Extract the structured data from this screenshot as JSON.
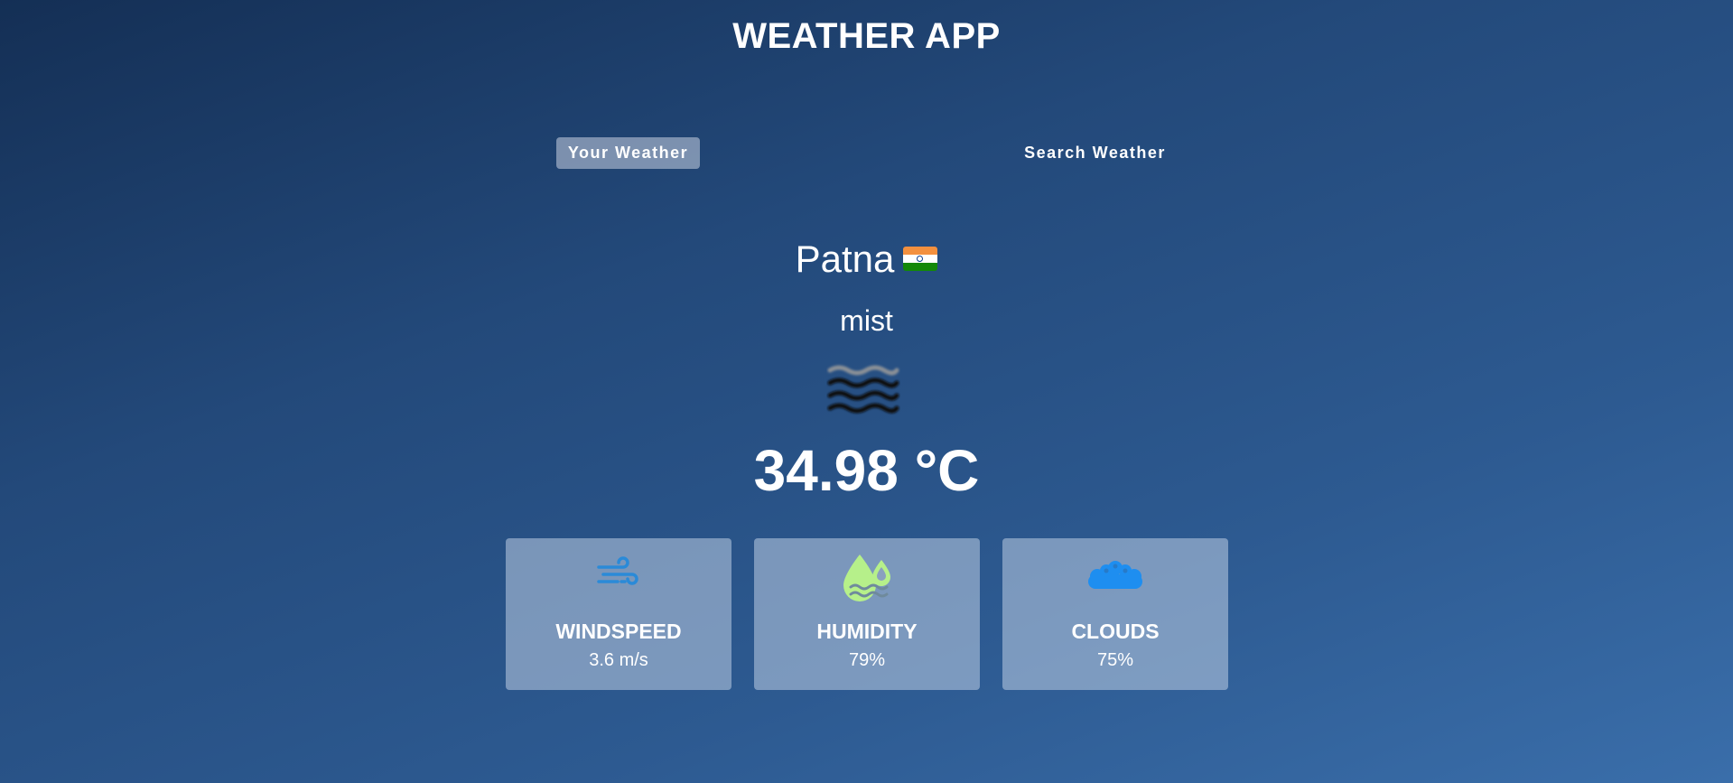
{
  "app": {
    "title": "WEATHER APP"
  },
  "tabs": [
    {
      "label": "Your Weather",
      "active": true
    },
    {
      "label": "Search Weather",
      "active": false
    }
  ],
  "location": {
    "city": "Patna",
    "flag_icon": "india-flag-icon"
  },
  "weather": {
    "condition": "mist",
    "condition_icon": "mist-icon",
    "temperature": "34.98 °C"
  },
  "stats": [
    {
      "label": "WINDSPEED",
      "value": "3.6 m/s",
      "icon": "wind-icon",
      "icon_color": "#2a8ad8"
    },
    {
      "label": "HUMIDITY",
      "value": "79%",
      "icon": "humidity-icon",
      "icon_color": "#b6f08a"
    },
    {
      "label": "CLOUDS",
      "value": "75%",
      "icon": "clouds-icon",
      "icon_color": "#1e8ef0"
    }
  ],
  "colors": {
    "background_start": "#142f55",
    "background_end": "#3a6eaa",
    "card_background": "#8aa0bf",
    "text": "#ffffff"
  }
}
